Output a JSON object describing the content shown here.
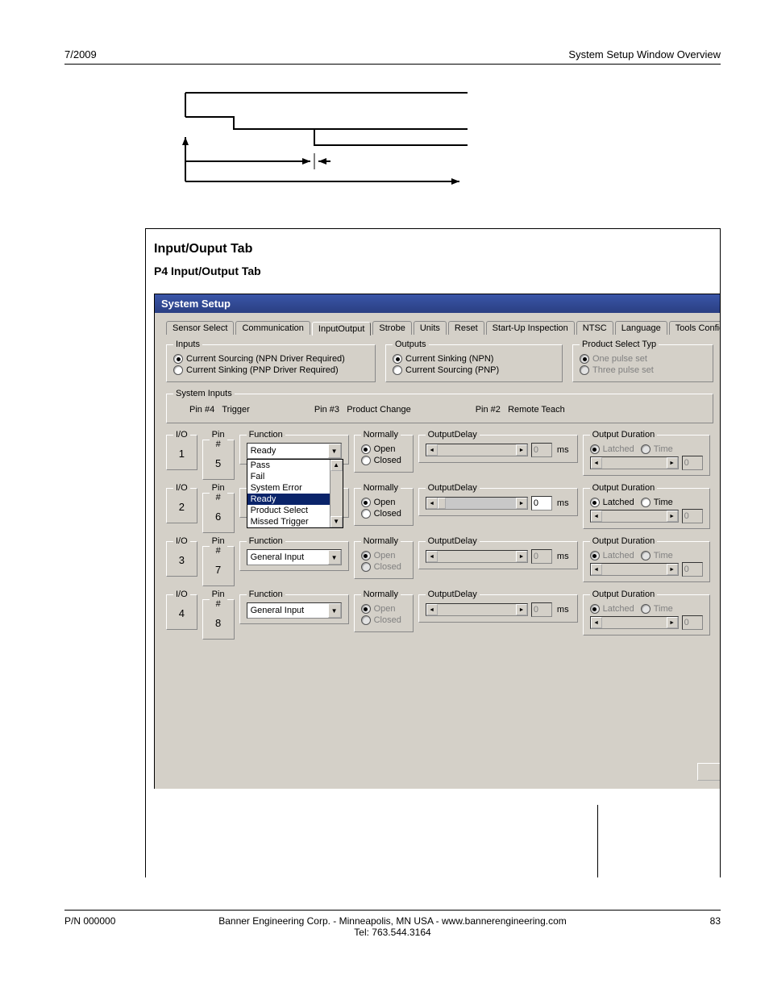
{
  "header": {
    "date": "7/2009",
    "title": "System Setup Window Overview"
  },
  "section": {
    "h1": "Input/Ouput Tab",
    "h2": "P4 Input/Output Tab"
  },
  "window": {
    "title": "System Setup"
  },
  "tabs": [
    "Sensor Select",
    "Communication",
    "InputOutput",
    "Strobe",
    "Units",
    "Reset",
    "Start-Up Inspection",
    "NTSC",
    "Language",
    "Tools Configurat"
  ],
  "inputs_group": {
    "legend": "Inputs",
    "opt1": "Current Sourcing  (NPN Driver Required)",
    "opt2": "Current Sinking   (PNP Driver Required)"
  },
  "outputs_group": {
    "legend": "Outputs",
    "opt1": "Current Sinking     (NPN)",
    "opt2": "Current Sourcing   (PNP)"
  },
  "pst_group": {
    "legend": "Product Select Typ",
    "opt1": "One pulse set",
    "opt2": "Three pulse set"
  },
  "sysinputs": {
    "legend": "System Inputs",
    "a_label": "Pin #4",
    "a_val": "Trigger",
    "b_label": "Pin #3",
    "b_val": "Product Change",
    "c_label": "Pin #2",
    "c_val": "Remote Teach"
  },
  "labels": {
    "io": "I/O",
    "pin": "Pin #",
    "func": "Function",
    "norm": "Normally",
    "open": "Open",
    "closed": "Closed",
    "outdelay": "OutputDelay",
    "outdur": "Output Duration",
    "latched": "Latched",
    "time": "Time",
    "ms": "ms"
  },
  "func_list": [
    "Pass",
    "Fail",
    "System Error",
    "Ready",
    "Product Select",
    "Missed Trigger"
  ],
  "rows": [
    {
      "io": "1",
      "pin": "5",
      "func": "Ready",
      "dropdown_open": true,
      "norm_enabled": true,
      "delay_enabled": false,
      "dur_enabled": false,
      "delay": "0",
      "dur": "0"
    },
    {
      "io": "2",
      "pin": "6",
      "func": "",
      "dropdown_open": false,
      "norm_enabled": true,
      "delay_enabled": true,
      "dur_enabled": true,
      "delay": "0",
      "dur": "0"
    },
    {
      "io": "3",
      "pin": "7",
      "func": "General Input",
      "dropdown_open": false,
      "norm_enabled": false,
      "delay_enabled": false,
      "dur_enabled": false,
      "delay": "0",
      "dur": "0"
    },
    {
      "io": "4",
      "pin": "8",
      "func": "General Input",
      "dropdown_open": false,
      "norm_enabled": false,
      "delay_enabled": false,
      "dur_enabled": false,
      "delay": "0",
      "dur": "0"
    }
  ],
  "footer": {
    "pn": "P/N 000000",
    "center1": "Banner Engineering Corp. - Minneapolis, MN USA - www.bannerengineering.com",
    "center2": "Tel: 763.544.3164",
    "page": "83"
  }
}
